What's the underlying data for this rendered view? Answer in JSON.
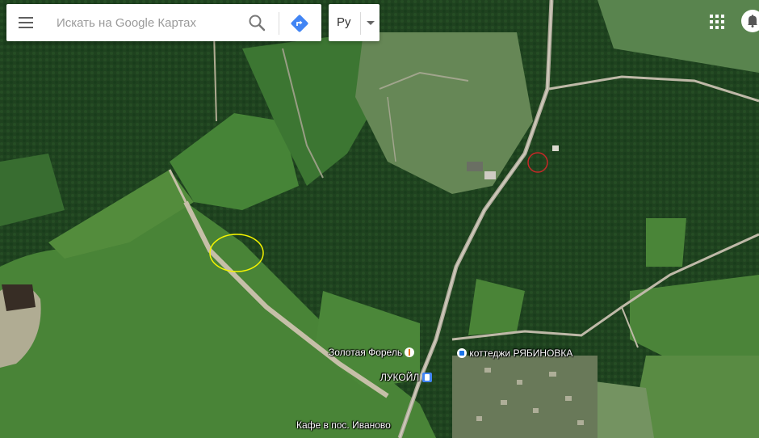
{
  "search": {
    "placeholder": "Искать на Google Картах"
  },
  "language": {
    "label": "Ру"
  },
  "pois": [
    {
      "label": "Золотая Форель",
      "icon": "restaurant-icon"
    },
    {
      "label": "коттеджи РЯБИНОВКА",
      "icon": "hotel-icon"
    },
    {
      "label": "ЛУКОЙЛ",
      "icon": "gas-station-icon"
    },
    {
      "label": "Кафе в пос. Иваново",
      "icon": "restaurant-icon"
    }
  ],
  "colors": {
    "accent": "#4285f4",
    "marker_yellow": "#f4f400",
    "marker_red": "#c62828"
  }
}
